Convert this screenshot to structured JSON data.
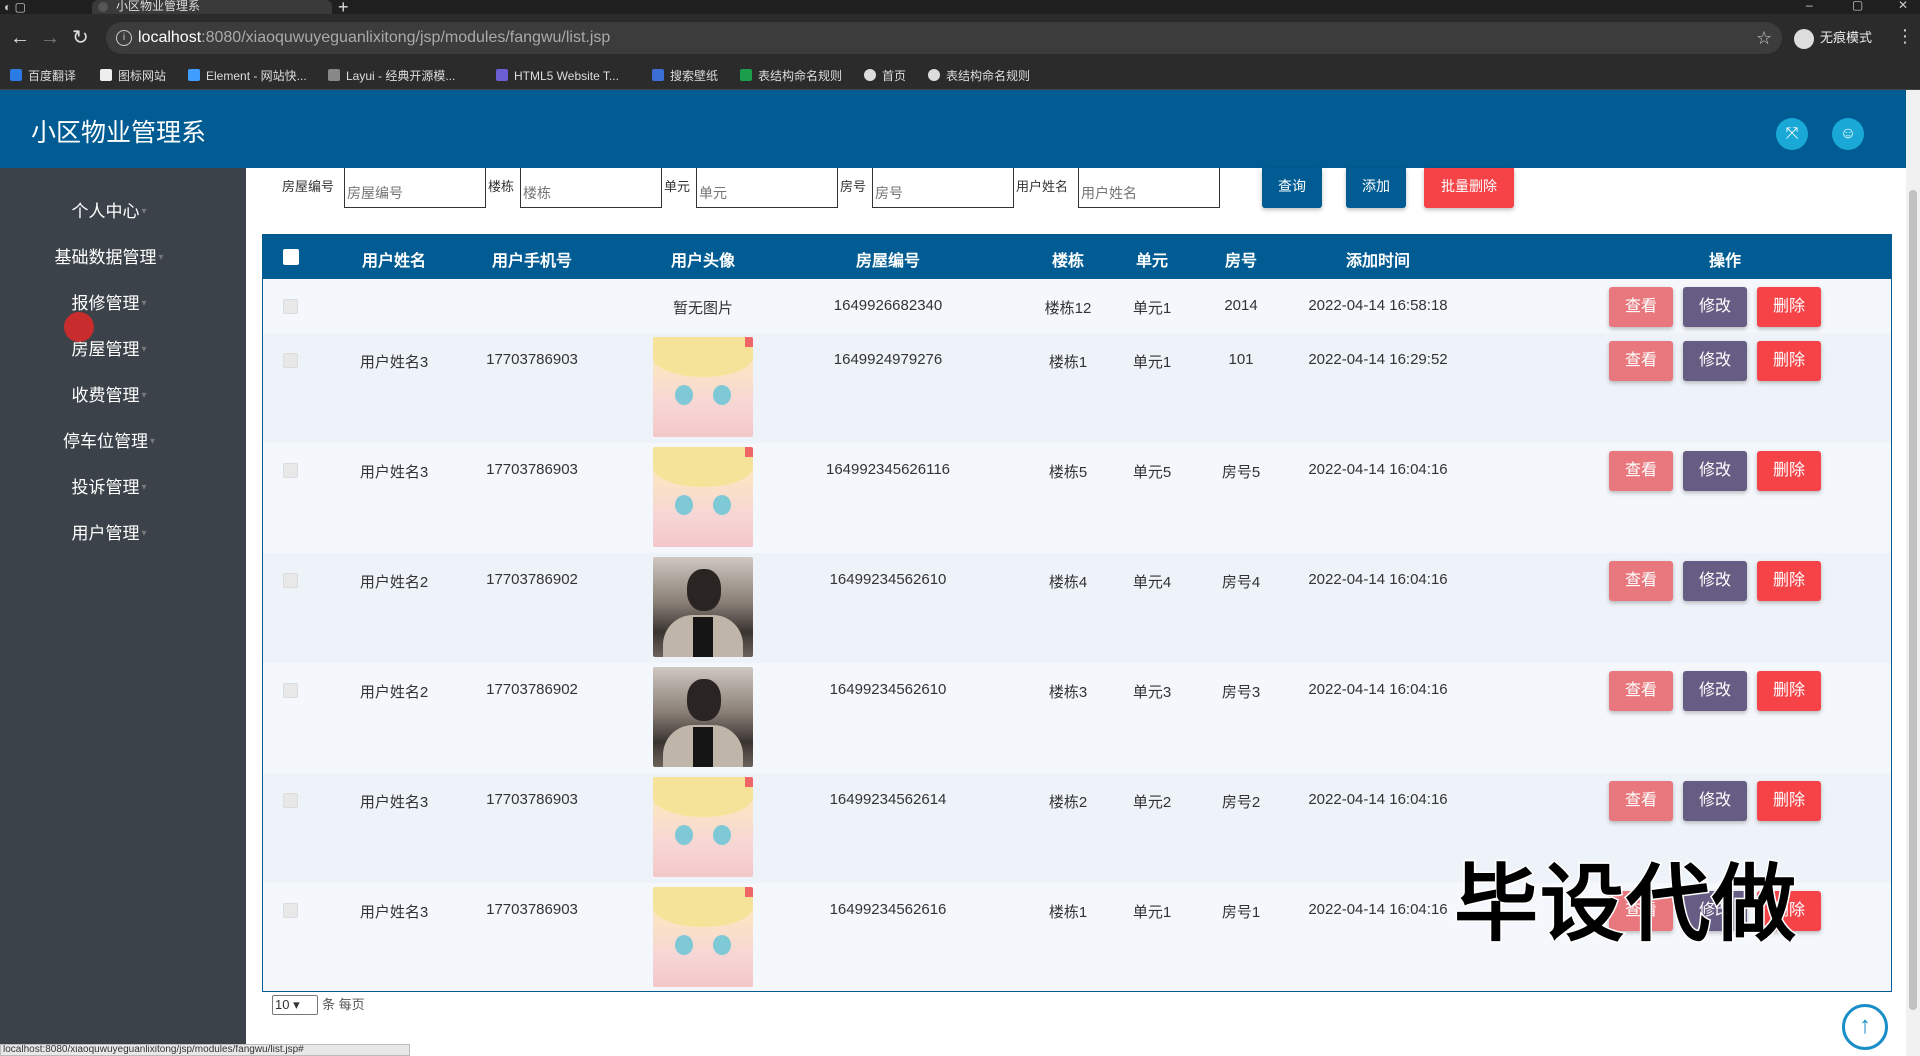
{
  "browser": {
    "tab_title": "小区物业管理系",
    "url_host": "localhost",
    "url_path": ":8080/xiaoquwuyeguanlixitong/jsp/modules/fangwu/list.jsp",
    "incognito_label": "无痕模式",
    "bookmarks": [
      "百度翻译",
      "图标网站",
      "Element - 网站快...",
      "Layui - 经典开源模...",
      "HTML5 Website T...",
      "搜索壁纸",
      "表结构命名规则",
      "首页",
      "表结构命名规则"
    ],
    "status_url": "localhost:8080/xiaoquwuyeguanlixitong/jsp/modules/fangwu/list.jsp#"
  },
  "header": {
    "title": "小区物业管理系"
  },
  "sidebar": {
    "items": [
      {
        "label": "个人中心"
      },
      {
        "label": "基础数据管理"
      },
      {
        "label": "报修管理"
      },
      {
        "label": "房屋管理"
      },
      {
        "label": "收费管理"
      },
      {
        "label": "停车位管理"
      },
      {
        "label": "投诉管理"
      },
      {
        "label": "用户管理"
      }
    ]
  },
  "search": {
    "fields": [
      {
        "label": "房屋编号",
        "placeholder": "房屋编号"
      },
      {
        "label": "楼栋",
        "placeholder": "楼栋"
      },
      {
        "label": "单元",
        "placeholder": "单元"
      },
      {
        "label": "房号",
        "placeholder": "房号"
      },
      {
        "label": "用户姓名",
        "placeholder": "用户姓名"
      }
    ],
    "query_label": "查询",
    "add_label": "添加",
    "batch_delete_label": "批量删除"
  },
  "table": {
    "columns": [
      "用户姓名",
      "用户手机号",
      "用户头像",
      "房屋编号",
      "楼栋",
      "单元",
      "房号",
      "添加时间",
      "操作"
    ],
    "no_image_text": "暂无图片",
    "rows": [
      {
        "name": "",
        "phone": "",
        "avatar": "none",
        "house_no": "1649926682340",
        "building": "楼栋12",
        "unit": "单元1",
        "room": "2014",
        "time": "2022-04-14 16:58:18"
      },
      {
        "name": "用户姓名3",
        "phone": "17703786903",
        "avatar": "anime",
        "house_no": "1649924979276",
        "building": "楼栋1",
        "unit": "单元1",
        "room": "101",
        "time": "2022-04-14 16:29:52"
      },
      {
        "name": "用户姓名3",
        "phone": "17703786903",
        "avatar": "anime",
        "house_no": "164992345626116",
        "building": "楼栋5",
        "unit": "单元5",
        "room": "房号5",
        "time": "2022-04-14 16:04:16"
      },
      {
        "name": "用户姓名2",
        "phone": "17703786902",
        "avatar": "photo",
        "house_no": "16499234562610",
        "building": "楼栋4",
        "unit": "单元4",
        "room": "房号4",
        "time": "2022-04-14 16:04:16"
      },
      {
        "name": "用户姓名2",
        "phone": "17703786902",
        "avatar": "photo",
        "house_no": "16499234562610",
        "building": "楼栋3",
        "unit": "单元3",
        "room": "房号3",
        "time": "2022-04-14 16:04:16"
      },
      {
        "name": "用户姓名3",
        "phone": "17703786903",
        "avatar": "anime",
        "house_no": "16499234562614",
        "building": "楼栋2",
        "unit": "单元2",
        "room": "房号2",
        "time": "2022-04-14 16:04:16"
      },
      {
        "name": "用户姓名3",
        "phone": "17703786903",
        "avatar": "anime",
        "house_no": "16499234562616",
        "building": "楼栋1",
        "unit": "单元1",
        "room": "房号1",
        "time": "2022-04-14 16:04:16"
      }
    ],
    "actions": {
      "view": "查看",
      "edit": "修改",
      "delete": "删除"
    }
  },
  "pager": {
    "page_size": "10",
    "per_page_label": "条 每页"
  },
  "watermark": "毕设代做",
  "colors": {
    "header_bg": "#005c92",
    "sidebar_bg": "#3b4249",
    "view_btn": "#e8777e",
    "edit_btn": "#675d84",
    "delete_btn": "#f54348"
  }
}
